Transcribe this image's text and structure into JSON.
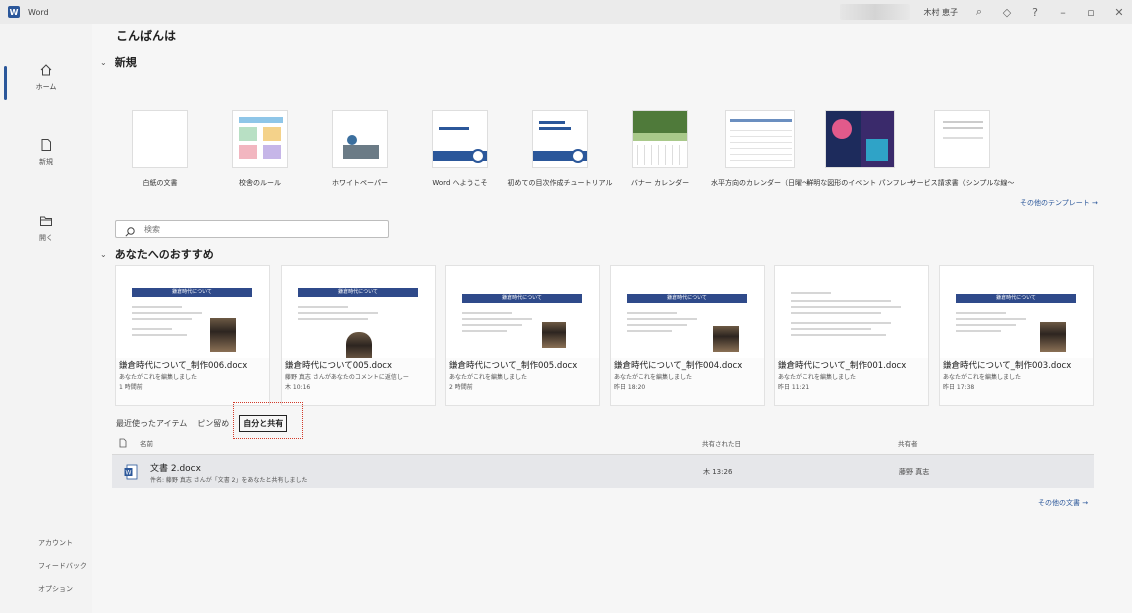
{
  "titlebar": {
    "app_name": "Word",
    "user_name": "木村 恵子"
  },
  "rail": {
    "items": [
      {
        "label": "ホーム",
        "icon": "home-icon"
      },
      {
        "label": "新規",
        "icon": "new-document-icon"
      },
      {
        "label": "開く",
        "icon": "open-folder-icon"
      }
    ],
    "bottom": [
      "アカウント",
      "フィードバック",
      "オプション"
    ]
  },
  "greeting": "こんばんは",
  "new_section": {
    "title": "新規",
    "templates": [
      "白紙の文書",
      "校舎のルール",
      "ホワイトペーパー",
      "Word へようこそ",
      "初めての目次作成チュートリアル",
      "バナー カレンダー",
      "水平方向のカレンダー（日曜～",
      "鮮明な図形のイベント パンフレー",
      "サービス請求書（シンプルな線～"
    ],
    "more_link": "その他のテンプレート →"
  },
  "search": {
    "placeholder": "検索"
  },
  "recommended": {
    "title": "あなたへのおすすめ",
    "banner_text": "鎌倉時代について",
    "cards": [
      {
        "name": "鎌倉時代について_制作006.docx",
        "info": "あなたがこれを編集しました",
        "time": "1 時間前"
      },
      {
        "name": "鎌倉時代について005.docx",
        "info": "藤野 真志 さんがあなたのコメントに返信しー",
        "time": "木 10:16"
      },
      {
        "name": "鎌倉時代について_制作005.docx",
        "info": "あなたがこれを編集しました",
        "time": "2 時間前"
      },
      {
        "name": "鎌倉時代について_制作004.docx",
        "info": "あなたがこれを編集しました",
        "time": "昨日 18:20"
      },
      {
        "name": "鎌倉時代について_制作001.docx",
        "info": "あなたがこれを編集しました",
        "time": "昨日 11:21"
      },
      {
        "name": "鎌倉時代について_制作003.docx",
        "info": "あなたがこれを編集しました",
        "time": "昨日 17:38"
      }
    ]
  },
  "tabs": [
    "最近使ったアイテム",
    "ピン留め",
    "自分と共有"
  ],
  "files": {
    "columns": {
      "name": "名前",
      "shared_date": "共有された日",
      "owner": "共有者"
    },
    "rows": [
      {
        "name": "文書 2.docx",
        "desc": "件名: 藤野 真志 さんが「文書 2」をあなたと共有しました",
        "date": "木 13:26",
        "owner": "藤野 真志"
      }
    ],
    "more_link": "その他の文書 →"
  },
  "colors": {
    "accent": "#2b579a",
    "highlight": "#d23b2a",
    "banner": "#2f4a8a"
  }
}
